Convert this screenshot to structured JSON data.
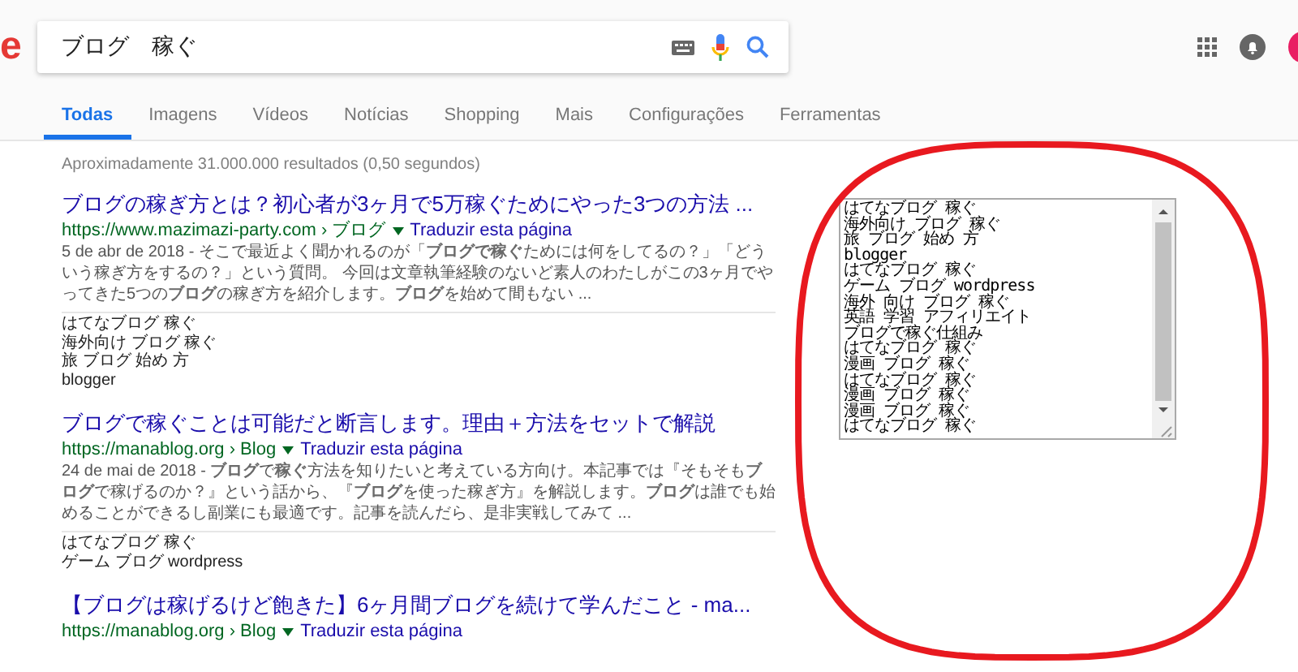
{
  "header": {
    "logo_text": "e",
    "search": {
      "value": "ブログ　稼ぐ"
    }
  },
  "tabs": [
    {
      "label": "Todas",
      "selected": true
    },
    {
      "label": "Imagens",
      "selected": false
    },
    {
      "label": "Vídeos",
      "selected": false
    },
    {
      "label": "Notícias",
      "selected": false
    },
    {
      "label": "Shopping",
      "selected": false
    },
    {
      "label": "Mais",
      "selected": false
    },
    {
      "label": "Configurações",
      "selected": false
    },
    {
      "label": "Ferramentas",
      "selected": false
    }
  ],
  "result_stats": "Aproximadamente 31.000.000 resultados (0,50 segundos)",
  "results": [
    {
      "title": "ブログの稼ぎ方とは？初心者が3ヶ月で5万稼ぐためにやった3つの方法 ...",
      "url": "https://www.mazimazi-party.com › ブログ",
      "translate": "Traduzir esta página",
      "snippet": "5 de abr de 2018 - そこで最近よく聞かれるのが「**ブログで稼ぐ**ためには何をしてるの？」「どういう稼ぎ方をするの？」という質問。 今回は文章執筆経験のないど素人のわたしがこの3ヶ月でやってきた5つの**ブログ**の稼ぎ方を紹介します。**ブログ**を始めて間もない ...",
      "related": [
        "はてなブログ 稼ぐ",
        "海外向け ブログ 稼ぐ",
        "旅 ブログ 始め 方",
        "blogger"
      ]
    },
    {
      "title": "ブログで稼ぐことは可能だと断言します。理由＋方法をセットで解説",
      "url": "https://manablog.org › Blog",
      "translate": "Traduzir esta página",
      "snippet": "24 de mai de 2018 - **ブログ**で**稼ぐ**方法を知りたいと考えている方向け。本記事では『そもそも**ブログ**で稼げるのか？』という話から、『**ブログ**を使った稼ぎ方』を解説します。**ブログ**は誰でも始めることができるし副業にも最適です。記事を読んだら、是非実戦してみて ...",
      "related": [
        "はてなブログ 稼ぐ",
        "ゲーム ブログ wordpress"
      ]
    },
    {
      "title": "【ブログは稼げるけど飽きた】6ヶ月間ブログを続けて学んだこと - ma...",
      "url": "https://manablog.org › Blog",
      "translate": "Traduzir esta página"
    }
  ],
  "textarea": {
    "lines": [
      "はてなブログ 稼ぐ",
      "海外向け ブログ 稼ぐ",
      "旅 ブログ 始め 方",
      "blogger",
      "はてなブログ 稼ぐ",
      "ゲーム ブログ wordpress",
      "海外 向け ブログ 稼ぐ",
      "英語 学習 アフィリエイト",
      "ブログで稼ぐ仕組み",
      "はてなブログ 稼ぐ",
      "漫画 ブログ 稼ぐ",
      "はてなブログ 稼ぐ",
      "漫画 ブログ 稼ぐ",
      "漫画 ブログ 稼ぐ",
      "はてなブログ 稼ぐ"
    ]
  }
}
